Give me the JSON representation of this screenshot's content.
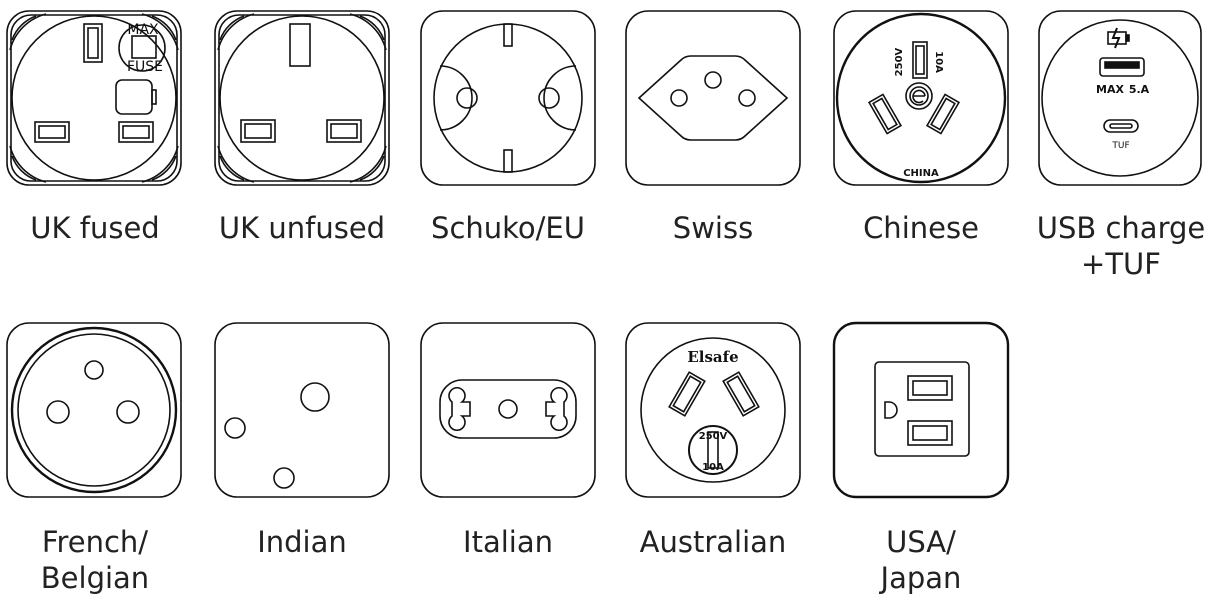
{
  "sockets": [
    {
      "id": "uk-fused",
      "label": "UK fused",
      "icon": "uk-fused-socket-icon",
      "texts": {
        "max": "MAX",
        "fuse": "FUSE"
      }
    },
    {
      "id": "uk-unfused",
      "label": "UK unfused",
      "icon": "uk-unfused-socket-icon"
    },
    {
      "id": "schuko",
      "label": "Schuko/EU",
      "icon": "schuko-socket-icon"
    },
    {
      "id": "swiss",
      "label": "Swiss",
      "icon": "swiss-socket-icon"
    },
    {
      "id": "chinese",
      "label": "Chinese",
      "icon": "chinese-socket-icon",
      "texts": {
        "volt": "250V",
        "amp": "10A",
        "country": "CHINA"
      }
    },
    {
      "id": "usb",
      "label": "USB charge\n+TUF",
      "icon": "usb-charge-socket-icon",
      "texts": {
        "max": "MAX",
        "amp": "5.A",
        "tuf": "TUF"
      }
    },
    {
      "id": "french",
      "label": "French/\nBelgian",
      "icon": "french-belgian-socket-icon"
    },
    {
      "id": "indian",
      "label": "Indian",
      "icon": "indian-socket-icon"
    },
    {
      "id": "italian",
      "label": "Italian",
      "icon": "italian-socket-icon"
    },
    {
      "id": "australian",
      "label": "Australian",
      "icon": "australian-socket-icon",
      "texts": {
        "brand": "Elsafe",
        "volt": "250V",
        "amp": "10A"
      }
    },
    {
      "id": "usa",
      "label": "USA/\nJapan",
      "icon": "usa-japan-socket-icon"
    }
  ]
}
